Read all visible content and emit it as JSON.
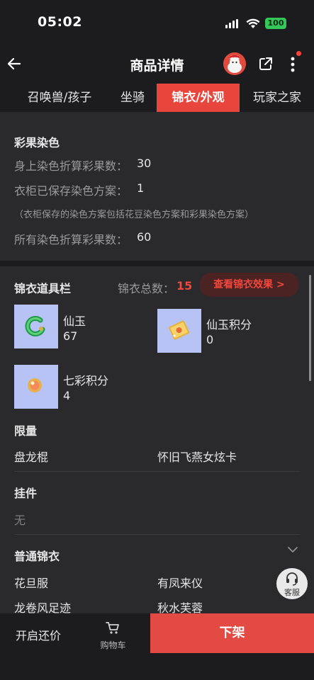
{
  "status": {
    "time": "05:02",
    "battery": "100"
  },
  "nav": {
    "title": "商品详情"
  },
  "tabs": [
    {
      "label": "召唤兽/孩子"
    },
    {
      "label": "坐骑"
    },
    {
      "label": "锦衣/外观"
    },
    {
      "label": "玩家之家"
    }
  ],
  "dye": {
    "title": "彩果染色",
    "rows": [
      {
        "label": "身上染色折算彩果数：",
        "value": "30"
      },
      {
        "label": "衣柜已保存染色方案：",
        "value": "1"
      }
    ],
    "note": "（衣柜保存的染色方案包括花豆染色方案和彩果染色方案）",
    "total_label": "所有染色折算彩果数：",
    "total_value": "60"
  },
  "props": {
    "title": "锦衣道具栏",
    "total_label": "锦衣总数：",
    "total_value": "15",
    "effect_button": "查看锦衣效果 >",
    "items": [
      {
        "name": "仙玉",
        "count": "67",
        "icon": "jade-icon"
      },
      {
        "name": "仙玉积分",
        "count": "0",
        "icon": "ticket-icon"
      },
      {
        "name": "七彩积分",
        "count": "4",
        "icon": "orb-icon"
      }
    ]
  },
  "limited": {
    "title": "限量",
    "items": [
      "盘龙棍",
      "怀旧飞燕女炫卡"
    ]
  },
  "pendant": {
    "title": "挂件",
    "value": "无"
  },
  "normal": {
    "title": "普通锦衣",
    "items": [
      "花旦服",
      "有凤来仪",
      "龙卷风足迹",
      "秋水芙蓉"
    ]
  },
  "service": {
    "label": "客服"
  },
  "bottom": {
    "bargain": "开启还价",
    "cart": "购物车",
    "delist": "下架"
  },
  "colors": {
    "accent": "#e8453c",
    "highlight": "#f0483e",
    "background": "#1c1c1e",
    "card": "#2a2a2c"
  }
}
